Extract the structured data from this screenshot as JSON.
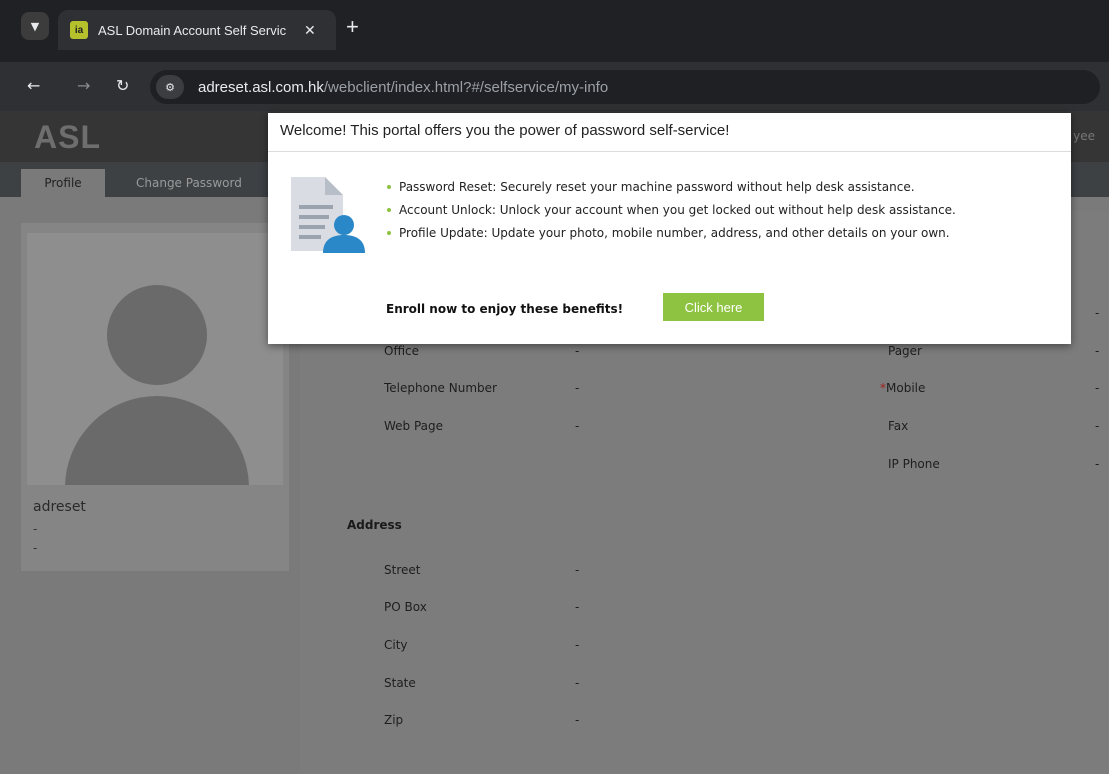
{
  "browser": {
    "tab_title": "ASL Domain Account Self Servic",
    "favicon_label": "ia",
    "url_host": "adreset.asl.com.hk",
    "url_path": "/webclient/index.html?#/selfservice/my-info",
    "icons": [
      "chevron-down-icon",
      "close-icon",
      "plus-icon",
      "back-icon",
      "forward-icon",
      "reload-icon",
      "site-settings-icon"
    ]
  },
  "app": {
    "logo": "ASL",
    "header_right_fragment": "yee",
    "nav_tabs": [
      {
        "label": "Profile",
        "active": true
      },
      {
        "label": "Change Password",
        "active": false
      }
    ]
  },
  "profile": {
    "username": "adreset",
    "line2": "-",
    "line3": "-"
  },
  "contact_fields_left": [
    {
      "label": "Office",
      "value": "-"
    },
    {
      "label": "Telephone Number",
      "value": "-"
    },
    {
      "label": "Web Page",
      "value": "-"
    }
  ],
  "contact_fields_right": [
    {
      "label": "",
      "value": "-"
    },
    {
      "label": "Pager",
      "value": "-"
    },
    {
      "label": "Mobile",
      "value": "-",
      "required": true
    },
    {
      "label": "Fax",
      "value": "-"
    },
    {
      "label": "IP Phone",
      "value": "-"
    }
  ],
  "address": {
    "title": "Address",
    "fields": [
      {
        "label": "Street",
        "value": "-"
      },
      {
        "label": "PO Box",
        "value": "-"
      },
      {
        "label": "City",
        "value": "-"
      },
      {
        "label": "State",
        "value": "-"
      },
      {
        "label": "Zip",
        "value": "-"
      }
    ]
  },
  "modal": {
    "title": "Welcome! This portal offers you the power of password self-service!",
    "benefits": [
      "Password Reset: Securely reset your machine password without help desk assistance.",
      "Account Unlock: Unlock your account when you get locked out without help desk assistance.",
      "Profile Update: Update your photo, mobile number, address, and other details on your own."
    ],
    "enroll_text": "Enroll now to enjoy these benefits!",
    "button_label": "Click here",
    "accent_color": "#8dc341"
  }
}
